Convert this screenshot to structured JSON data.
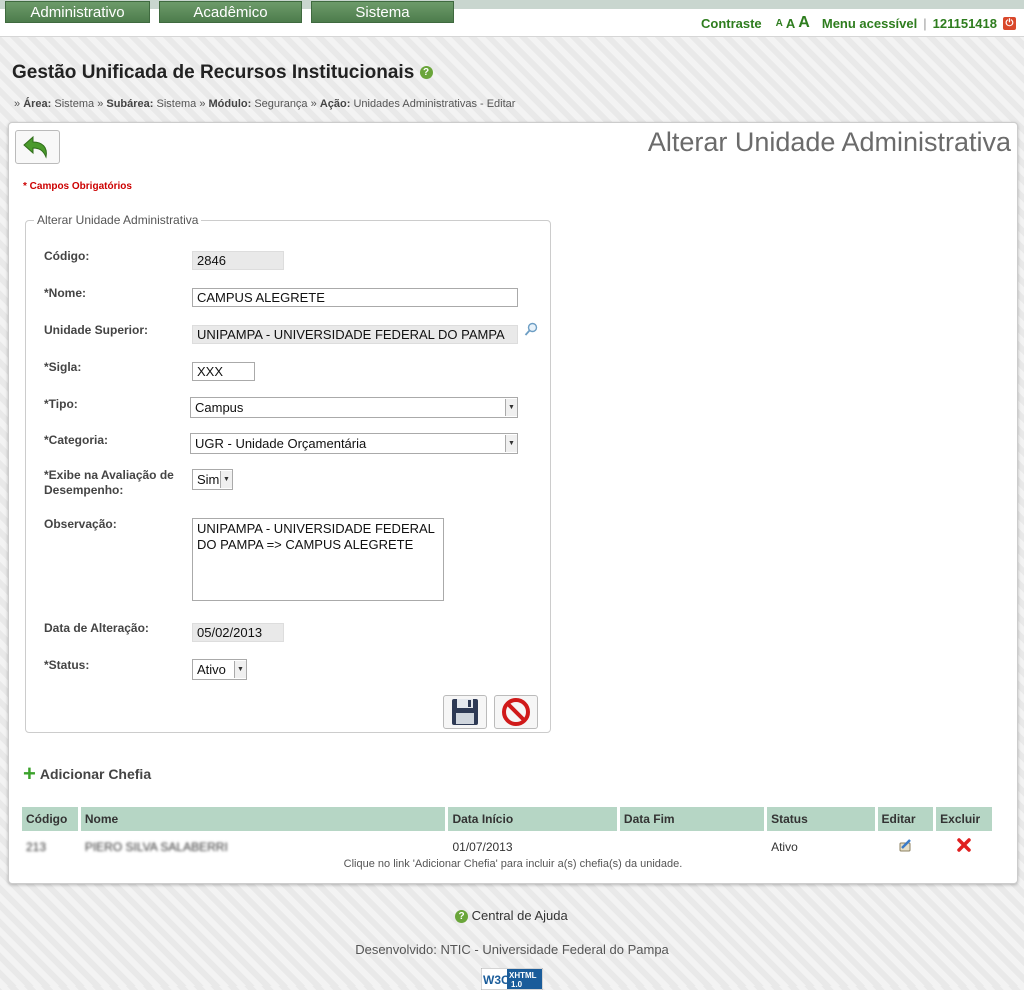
{
  "menu": {
    "tabs": [
      {
        "label": "Administrativo"
      },
      {
        "label": "Acadêmico"
      },
      {
        "label": "Sistema"
      }
    ]
  },
  "accessibility": {
    "contrast": "Contraste",
    "font_small": "A",
    "font_medium": "A",
    "font_large": "A",
    "menu_link": "Menu acessível",
    "separator": "|",
    "user_id": "121151418"
  },
  "header": {
    "title": "Gestão Unificada de Recursos Institucionais"
  },
  "breadcrumb": {
    "prefix": "»",
    "area_label": "Área:",
    "area_value": "Sistema",
    "subarea_label": "Subárea:",
    "subarea_value": "Sistema",
    "module_label": "Módulo:",
    "module_value": "Segurança",
    "action_label": "Ação:",
    "action_value": "Unidades Administrativas - Editar",
    "sep": "»"
  },
  "page": {
    "heading": "Alterar Unidade Administrativa",
    "required_note": "* Campos Obrigatórios"
  },
  "form": {
    "legend": "Alterar Unidade Administrativa",
    "codigo": {
      "label": "Código:",
      "value": "2846"
    },
    "nome": {
      "label": "*Nome:",
      "value": "CAMPUS ALEGRETE"
    },
    "unidade_superior": {
      "label": "Unidade Superior:",
      "value": "UNIPAMPA - UNIVERSIDADE FEDERAL DO PAMPA"
    },
    "sigla": {
      "label": "*Sigla:",
      "value": "XXX"
    },
    "tipo": {
      "label": "*Tipo:",
      "value": "Campus"
    },
    "categoria": {
      "label": "*Categoria:",
      "value": "UGR - Unidade Orçamentária"
    },
    "exibe": {
      "label_line1": "*Exibe na Avaliação de",
      "label_line2": "Desempenho:",
      "value": "Sim"
    },
    "observacao": {
      "label": "Observação:",
      "value": "UNIPAMPA - UNIVERSIDADE FEDERAL DO PAMPA => CAMPUS ALEGRETE"
    },
    "data_alteracao": {
      "label": "Data de Alteração:",
      "value": "05/02/2013"
    },
    "status": {
      "label": "*Status:",
      "value": "Ativo"
    }
  },
  "chefia": {
    "add_label": "Adicionar Chefia",
    "columns": [
      "Código",
      "Nome",
      "Data Início",
      "Data Fim",
      "Status",
      "Editar",
      "Excluir"
    ],
    "rows": [
      {
        "codigo": "213",
        "nome": "PIERO SILVA SALABERRI",
        "data_inicio": "01/07/2013",
        "data_fim": "",
        "status": "Ativo"
      }
    ],
    "note": "Clique no link 'Adicionar Chefia' para incluir a(s) chefia(s) da unidade."
  },
  "footer": {
    "help": "Central de Ajuda",
    "developed": "Desenvolvido: NTIC - Universidade Federal do Pampa",
    "badge_org": "W3C",
    "badge_label": "XHTML",
    "badge_version": "1.0"
  },
  "colors": {
    "menu_green": "#4d7c4c",
    "accent_green": "#2e7d1e",
    "table_header": "#b6d6c5",
    "required_red": "#cc0000"
  },
  "icons": {
    "back": "back-arrow-icon",
    "help": "help-icon",
    "lookup": "search-icon",
    "save": "save-disk-icon",
    "cancel": "cancel-icon",
    "add": "plus-icon",
    "edit": "edit-icon",
    "delete": "delete-icon",
    "logout": "power-icon"
  }
}
